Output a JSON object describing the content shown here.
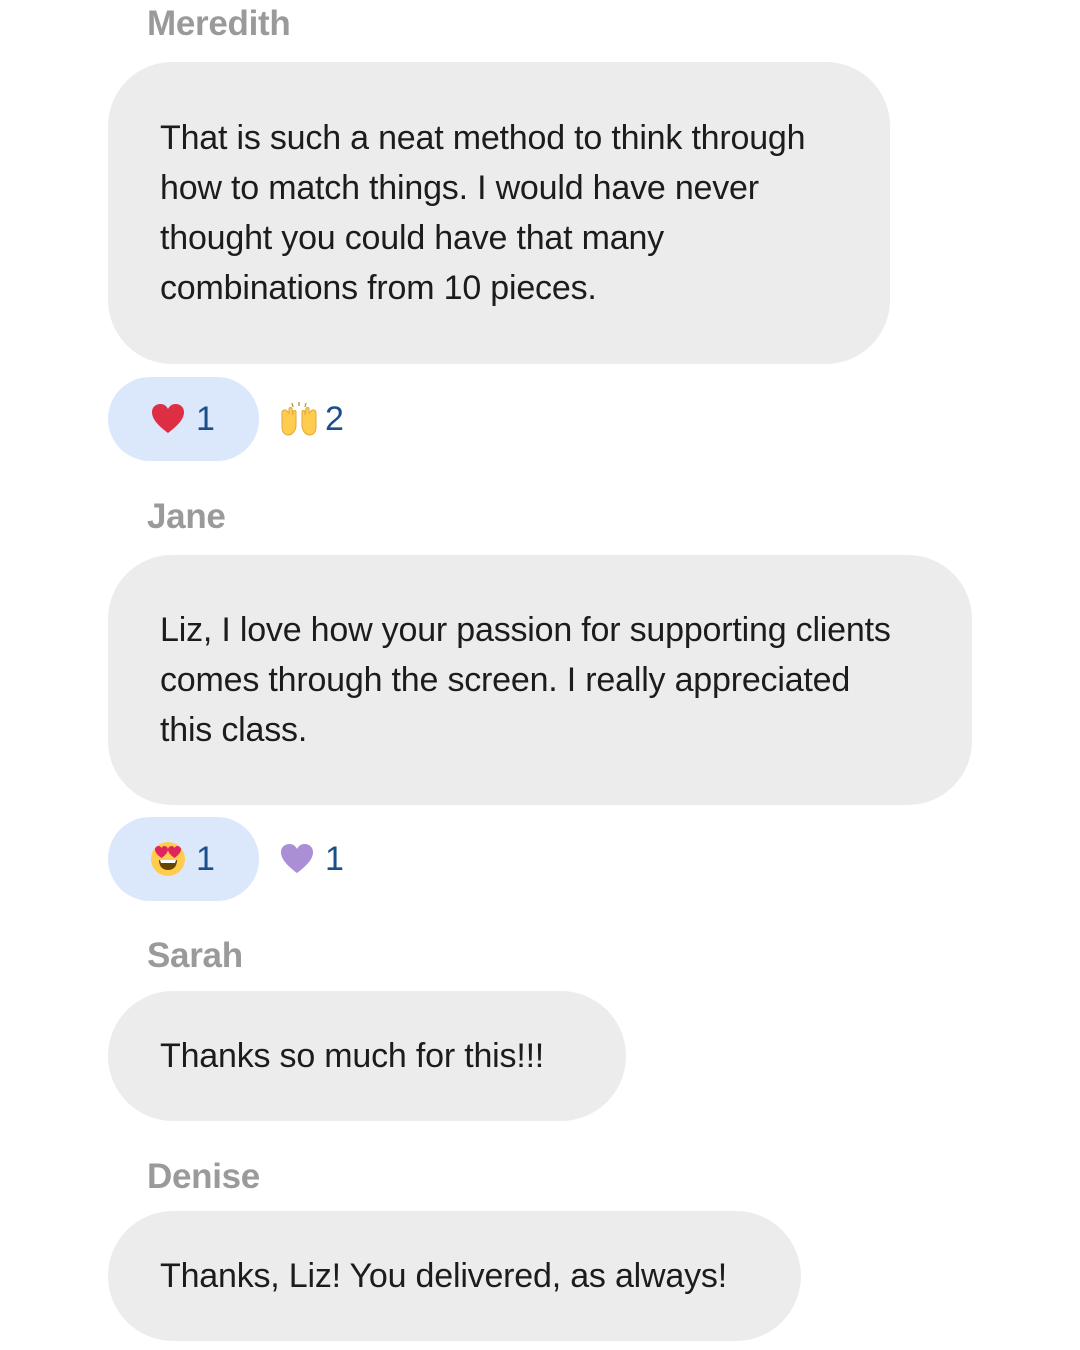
{
  "messages": [
    {
      "sender": "Meredith",
      "text": "That is such a neat method to think through\nhow to match things. I would have never\nthought you could have that many\ncombinations from 10 pieces.",
      "reactions": [
        {
          "icon": "red-heart-icon",
          "count": "1",
          "selected": true
        },
        {
          "icon": "raising-hands-icon",
          "count": "2",
          "selected": false
        }
      ]
    },
    {
      "sender": "Jane",
      "text": "Liz, I love how your passion for supporting clients\ncomes through the screen. I really appreciated\nthis class.",
      "reactions": [
        {
          "icon": "heart-eyes-face-icon",
          "count": "1",
          "selected": true
        },
        {
          "icon": "purple-heart-icon",
          "count": "1",
          "selected": false
        }
      ]
    },
    {
      "sender": "Sarah",
      "text": "Thanks so much for this!!!",
      "reactions": []
    },
    {
      "sender": "Denise",
      "text": "Thanks, Liz! You delivered, as always!",
      "reactions": []
    }
  ],
  "colors": {
    "bubble": "#ececec",
    "sender_name": "#9a9a9a",
    "reaction_selected_bg": "#dbe8fb",
    "reaction_count": "#1a4f8b"
  }
}
